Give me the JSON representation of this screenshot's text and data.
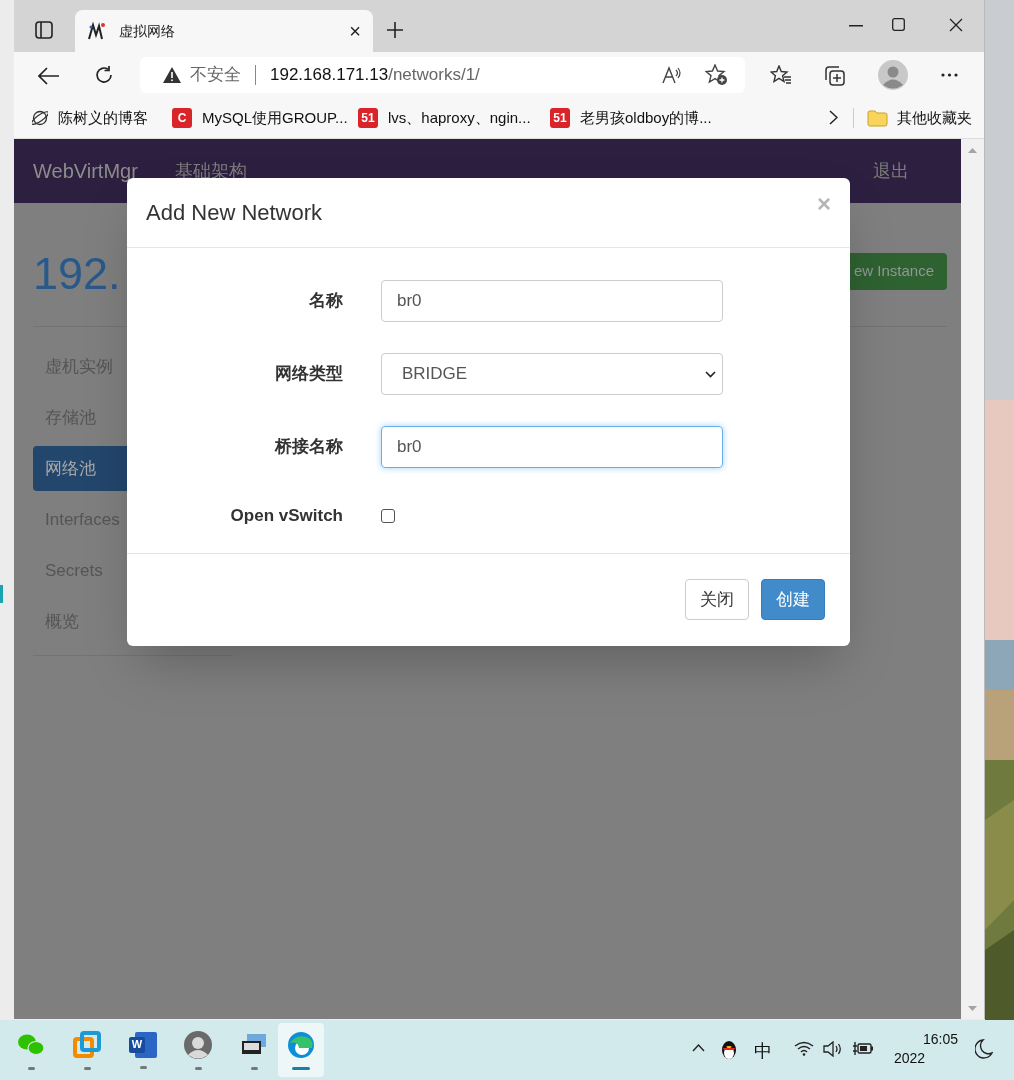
{
  "browser": {
    "tab": {
      "title": "虚拟网络",
      "close": "×"
    },
    "address": {
      "security": "不安全",
      "host": "192.168.171.13",
      "path": "/networks/1/"
    },
    "bookmarks": [
      {
        "kind": "globe",
        "label": "陈树义的博客"
      },
      {
        "kind": "badge",
        "badge": "C",
        "label": "MySQL使用GROUP..."
      },
      {
        "kind": "badge",
        "badge": "51",
        "label": "lvs、haproxy、ngin..."
      },
      {
        "kind": "badge",
        "badge": "51",
        "label": "老男孩oldboy的博..."
      }
    ],
    "other_bookmarks": "其他收藏夹"
  },
  "page": {
    "brand": "WebVirtMgr",
    "nav": [
      "基础架构"
    ],
    "logout": "退出",
    "heading": "192.",
    "new_instance": "ew Instance",
    "sidebar": [
      {
        "label": "虚机实例",
        "selected": false
      },
      {
        "label": "存储池",
        "selected": false
      },
      {
        "label": "网络池",
        "selected": true
      },
      {
        "label": "Interfaces",
        "selected": false
      },
      {
        "label": "Secrets",
        "selected": false
      },
      {
        "label": "概览",
        "selected": false
      }
    ]
  },
  "modal": {
    "title": "Add New Network",
    "close": "×",
    "fields": [
      {
        "kind": "text",
        "label": "名称",
        "value": "br0",
        "focused": false
      },
      {
        "kind": "select",
        "label": "网络类型",
        "value": "BRIDGE"
      },
      {
        "kind": "text",
        "label": "桥接名称",
        "value": "br0",
        "focused": true
      },
      {
        "kind": "checkbox",
        "label": "Open vSwitch",
        "checked": false
      }
    ],
    "buttons": [
      {
        "kind": "default",
        "label": "关闭"
      },
      {
        "kind": "primary",
        "label": "创建"
      }
    ]
  },
  "taskbar": {
    "apps": [
      {
        "kind": "wechat",
        "active": false
      },
      {
        "kind": "vmware",
        "active": false
      },
      {
        "kind": "word",
        "badge": "W",
        "active": false
      },
      {
        "kind": "avatar",
        "active": false
      },
      {
        "kind": "remote",
        "active": false
      },
      {
        "kind": "edge",
        "active": true
      }
    ],
    "ime": "中",
    "time": "16:05",
    "date": "2022"
  }
}
